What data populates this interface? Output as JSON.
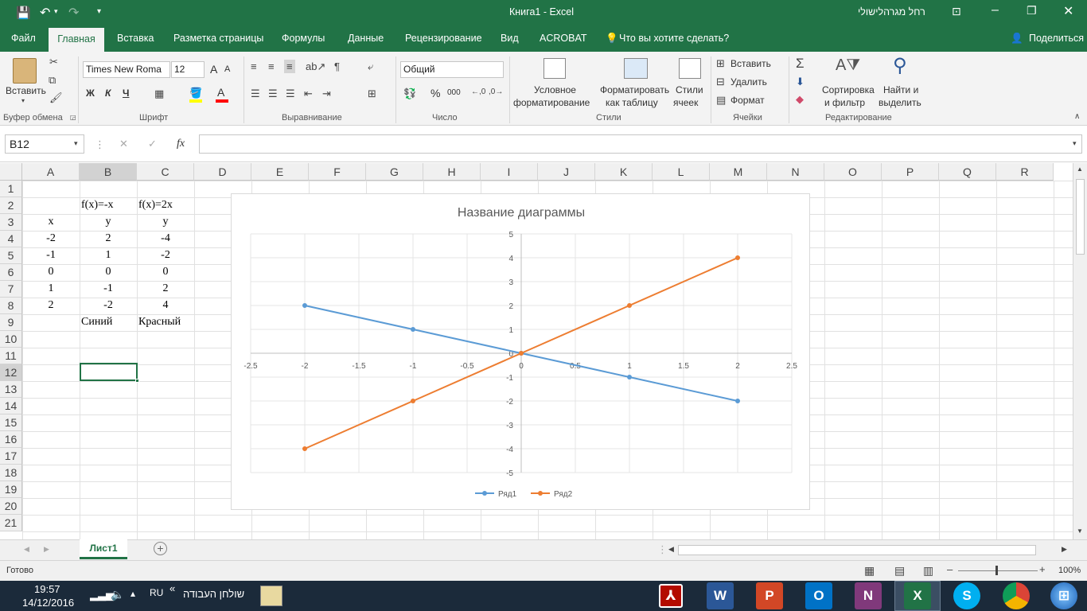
{
  "title_bar": {
    "document": "Книга1",
    "separator": " - ",
    "app": "Excel",
    "user": "רחל מגרהלישולי"
  },
  "menu": {
    "file": "Файл",
    "home": "Главная",
    "insert": "Вставка",
    "layout": "Разметка страницы",
    "formulas": "Формулы",
    "data": "Данные",
    "review": "Рецензирование",
    "view": "Вид",
    "acrobat": "ACROBAT",
    "tell_me": "Что вы хотите сделать?",
    "share": "Поделиться"
  },
  "ribbon": {
    "clipboard": {
      "paste": "Вставить",
      "label": "Буфер обмена"
    },
    "font": {
      "name": "Times New Roma",
      "size": "12",
      "bold": "Ж",
      "italic": "К",
      "underline": "Ч",
      "grow": "A",
      "shrink": "A",
      "color_a": "A",
      "label": "Шрифт"
    },
    "alignment": {
      "label": "Выравнивание"
    },
    "number": {
      "format": "Общий",
      "percent": "%",
      "thousands": "000",
      "label": "Число"
    },
    "styles": {
      "cond1": "Условное",
      "cond2": "форматирование",
      "table1": "Форматировать",
      "table2": "как таблицу",
      "cell1": "Стили",
      "cell2": "ячеек",
      "label": "Стили"
    },
    "cells": {
      "insert": "Вставить",
      "delete": "Удалить",
      "format": "Формат",
      "label": "Ячейки"
    },
    "editing": {
      "sort1": "Сортировка",
      "sort2": "и фильтр",
      "find1": "Найти и",
      "find2": "выделить",
      "label": "Редактирование"
    }
  },
  "formula_bar": {
    "name_box": "B12",
    "fx": "fx",
    "value": ""
  },
  "grid": {
    "columns": [
      "A",
      "B",
      "C",
      "D",
      "E",
      "F",
      "G",
      "H",
      "I",
      "J",
      "K",
      "L",
      "M",
      "N",
      "O",
      "P",
      "Q",
      "R"
    ],
    "rows": [
      "1",
      "2",
      "3",
      "4",
      "5",
      "6",
      "7",
      "8",
      "9",
      "10",
      "11",
      "12",
      "13",
      "14",
      "15",
      "16",
      "17",
      "18",
      "19",
      "20",
      "21"
    ],
    "cells": {
      "B2": "f(x)=-x",
      "C2": "f(x)=2x",
      "A3": "x",
      "B3": "y",
      "C3": "y",
      "A4": "-2",
      "B4": "2",
      "C4": "-4",
      "A5": "-1",
      "B5": "1",
      "C5": "-2",
      "A6": "0",
      "B6": "0",
      "C6": "0",
      "A7": "1",
      "B7": "-1",
      "C7": "2",
      "A8": "2",
      "B8": "-2",
      "C8": "4",
      "B9": "Синий",
      "C9": "Красный"
    }
  },
  "chart_data": {
    "type": "scatter",
    "title": "Название диаграммы",
    "xlim": [
      -2.5,
      2.5
    ],
    "ylim": [
      -5,
      5
    ],
    "x_ticks": [
      -2.5,
      -2,
      -1.5,
      -1,
      -0.5,
      0,
      0.5,
      1,
      1.5,
      2,
      2.5
    ],
    "y_ticks": [
      -5,
      -4,
      -3,
      -2,
      -1,
      0,
      1,
      2,
      3,
      4,
      5
    ],
    "grid": true,
    "legend": "bottom",
    "series": [
      {
        "name": "Ряд1",
        "color": "#5b9bd5",
        "x": [
          -2,
          -1,
          0,
          1,
          2
        ],
        "y": [
          2,
          1,
          0,
          -1,
          -2
        ]
      },
      {
        "name": "Ряд2",
        "color": "#ed7d31",
        "x": [
          -2,
          -1,
          0,
          1,
          2
        ],
        "y": [
          -4,
          -2,
          0,
          2,
          4
        ]
      }
    ]
  },
  "sheet_tabs": {
    "active": "Лист1",
    "add": "+"
  },
  "status_bar": {
    "status": "Готово",
    "zoom": "100%"
  },
  "taskbar": {
    "time": "19:57",
    "date": "14/12/2016",
    "lang": "RU",
    "desktop": "שולחן העבודה"
  },
  "colors": {
    "excel_green": "#217346",
    "series1": "#5b9bd5",
    "series2": "#ed7d31"
  }
}
